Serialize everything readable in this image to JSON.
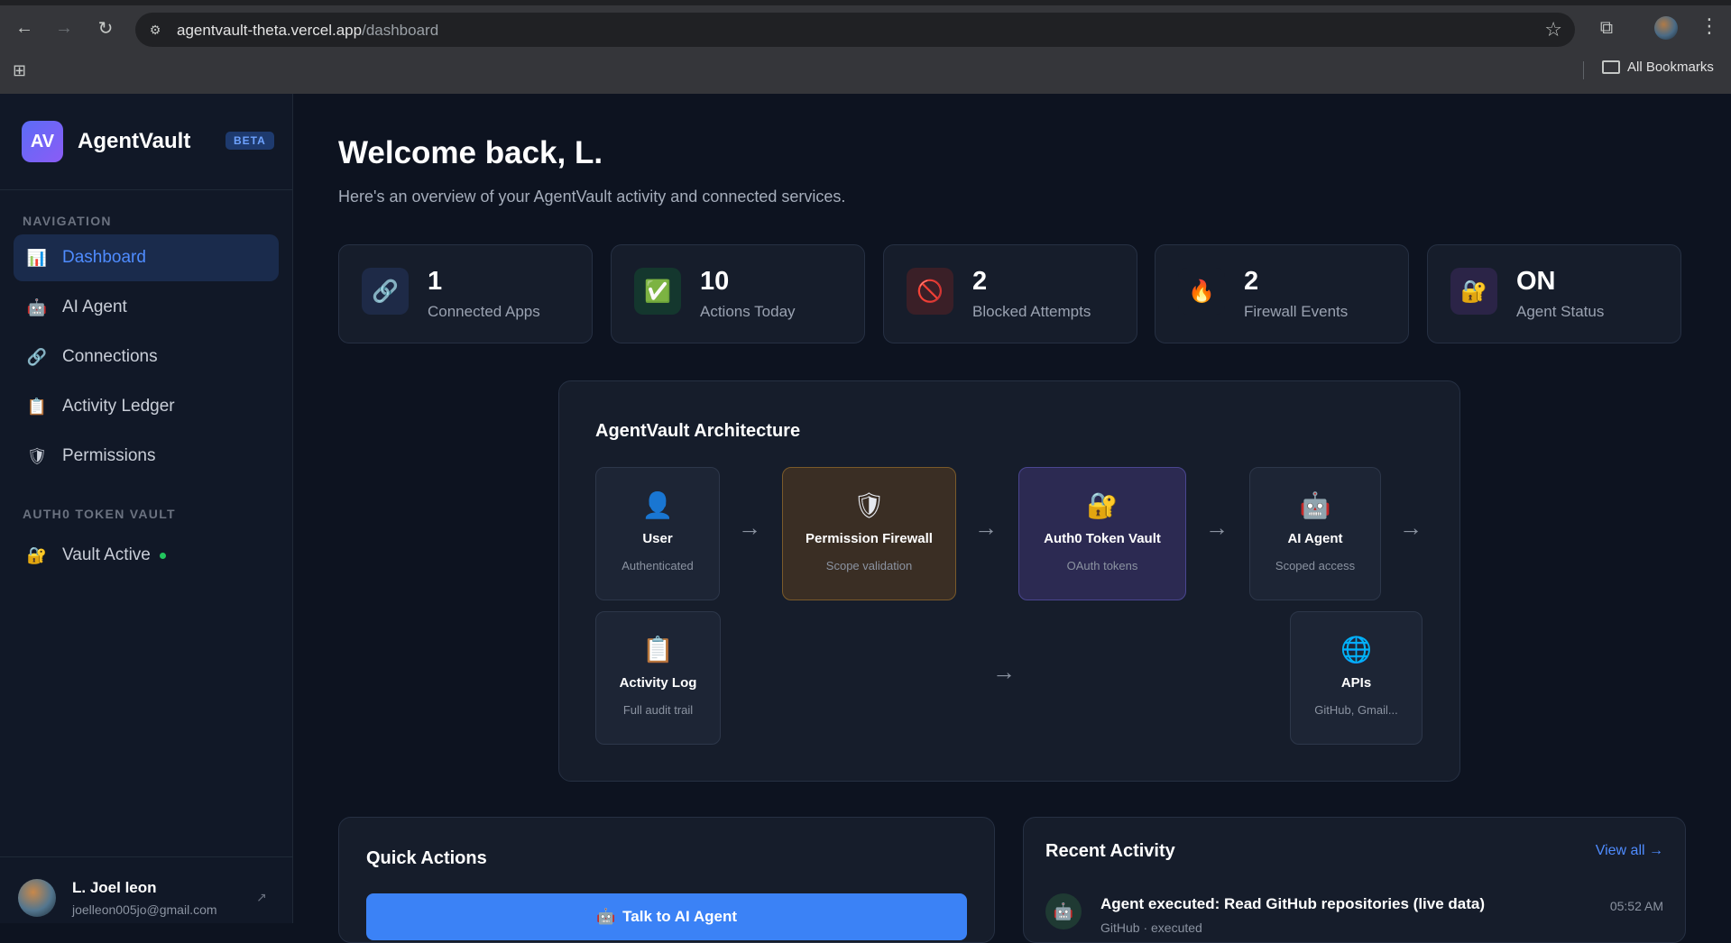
{
  "browser": {
    "url_host": "agentvault-theta.vercel.app",
    "url_path": "/dashboard",
    "bookmarks_label": "All Bookmarks"
  },
  "sidebar": {
    "logo_text": "AV",
    "brand": "AgentVault",
    "beta": "BETA",
    "nav_section": "NAVIGATION",
    "items": [
      {
        "label": "Dashboard",
        "icon": "bar-chart-icon",
        "glyph": "📊"
      },
      {
        "label": "AI Agent",
        "icon": "robot-icon",
        "glyph": "🤖"
      },
      {
        "label": "Connections",
        "icon": "link-icon",
        "glyph": "🔗"
      },
      {
        "label": "Activity Ledger",
        "icon": "clipboard-icon",
        "glyph": "📋"
      },
      {
        "label": "Permissions",
        "icon": "shield-icon",
        "glyph": "🛡"
      }
    ],
    "vault_section": "AUTH0 TOKEN VAULT",
    "vault_item": {
      "label": "Vault Active",
      "icon": "lock-icon",
      "glyph": "🔐"
    },
    "user": {
      "name": "L. Joel leon",
      "email": "joelleon005jo@gmail.com",
      "link_glyph": "↗"
    }
  },
  "main": {
    "welcome": "Welcome back, L.",
    "subtitle": "Here's an overview of your AgentVault activity and connected services.",
    "stats": [
      {
        "value": "1",
        "label": "Connected Apps",
        "icon": "link-icon",
        "glyph": "🔗"
      },
      {
        "value": "10",
        "label": "Actions Today",
        "icon": "check-icon",
        "glyph": "✅"
      },
      {
        "value": "2",
        "label": "Blocked Attempts",
        "icon": "blocked-icon",
        "glyph": "🚫"
      },
      {
        "value": "2",
        "label": "Firewall Events",
        "icon": "fire-icon",
        "glyph": "🔥"
      },
      {
        "value": "ON",
        "label": "Agent Status",
        "icon": "lock-icon",
        "glyph": "🔐"
      }
    ],
    "architecture": {
      "title": "AgentVault Architecture",
      "nodes": [
        {
          "title": "User",
          "sub": "Authenticated",
          "icon": "user-icon",
          "glyph": "👤"
        },
        {
          "title": "Permission Firewall",
          "sub": "Scope validation",
          "icon": "shield-icon",
          "glyph": "🛡"
        },
        {
          "title": "Auth0 Token Vault",
          "sub": "OAuth tokens",
          "icon": "lock-icon",
          "glyph": "🔐"
        },
        {
          "title": "AI Agent",
          "sub": "Scoped access",
          "icon": "robot-icon",
          "glyph": "🤖"
        },
        {
          "title": "Activity Log",
          "sub": "Full audit trail",
          "icon": "clipboard-icon",
          "glyph": "📋"
        },
        {
          "title": "APIs",
          "sub": "GitHub, Gmail...",
          "icon": "globe-icon",
          "glyph": "🌐"
        }
      ],
      "arrow": "→"
    },
    "quick_actions": {
      "title": "Quick Actions",
      "talk_button": "Talk to AI Agent",
      "talk_glyph": "🤖"
    },
    "recent_activity": {
      "title": "Recent Activity",
      "view_all": "View all →",
      "items": [
        {
          "title": "Agent executed: Read GitHub repositories (live data)",
          "sub": "GitHub · executed",
          "time": "05:52 AM",
          "glyph": "🤖"
        }
      ]
    }
  },
  "colors": {
    "accent": "#3b82f6",
    "sidebar_bg": "#111827",
    "main_bg": "#0d1320",
    "status_green": "#22c55e"
  }
}
